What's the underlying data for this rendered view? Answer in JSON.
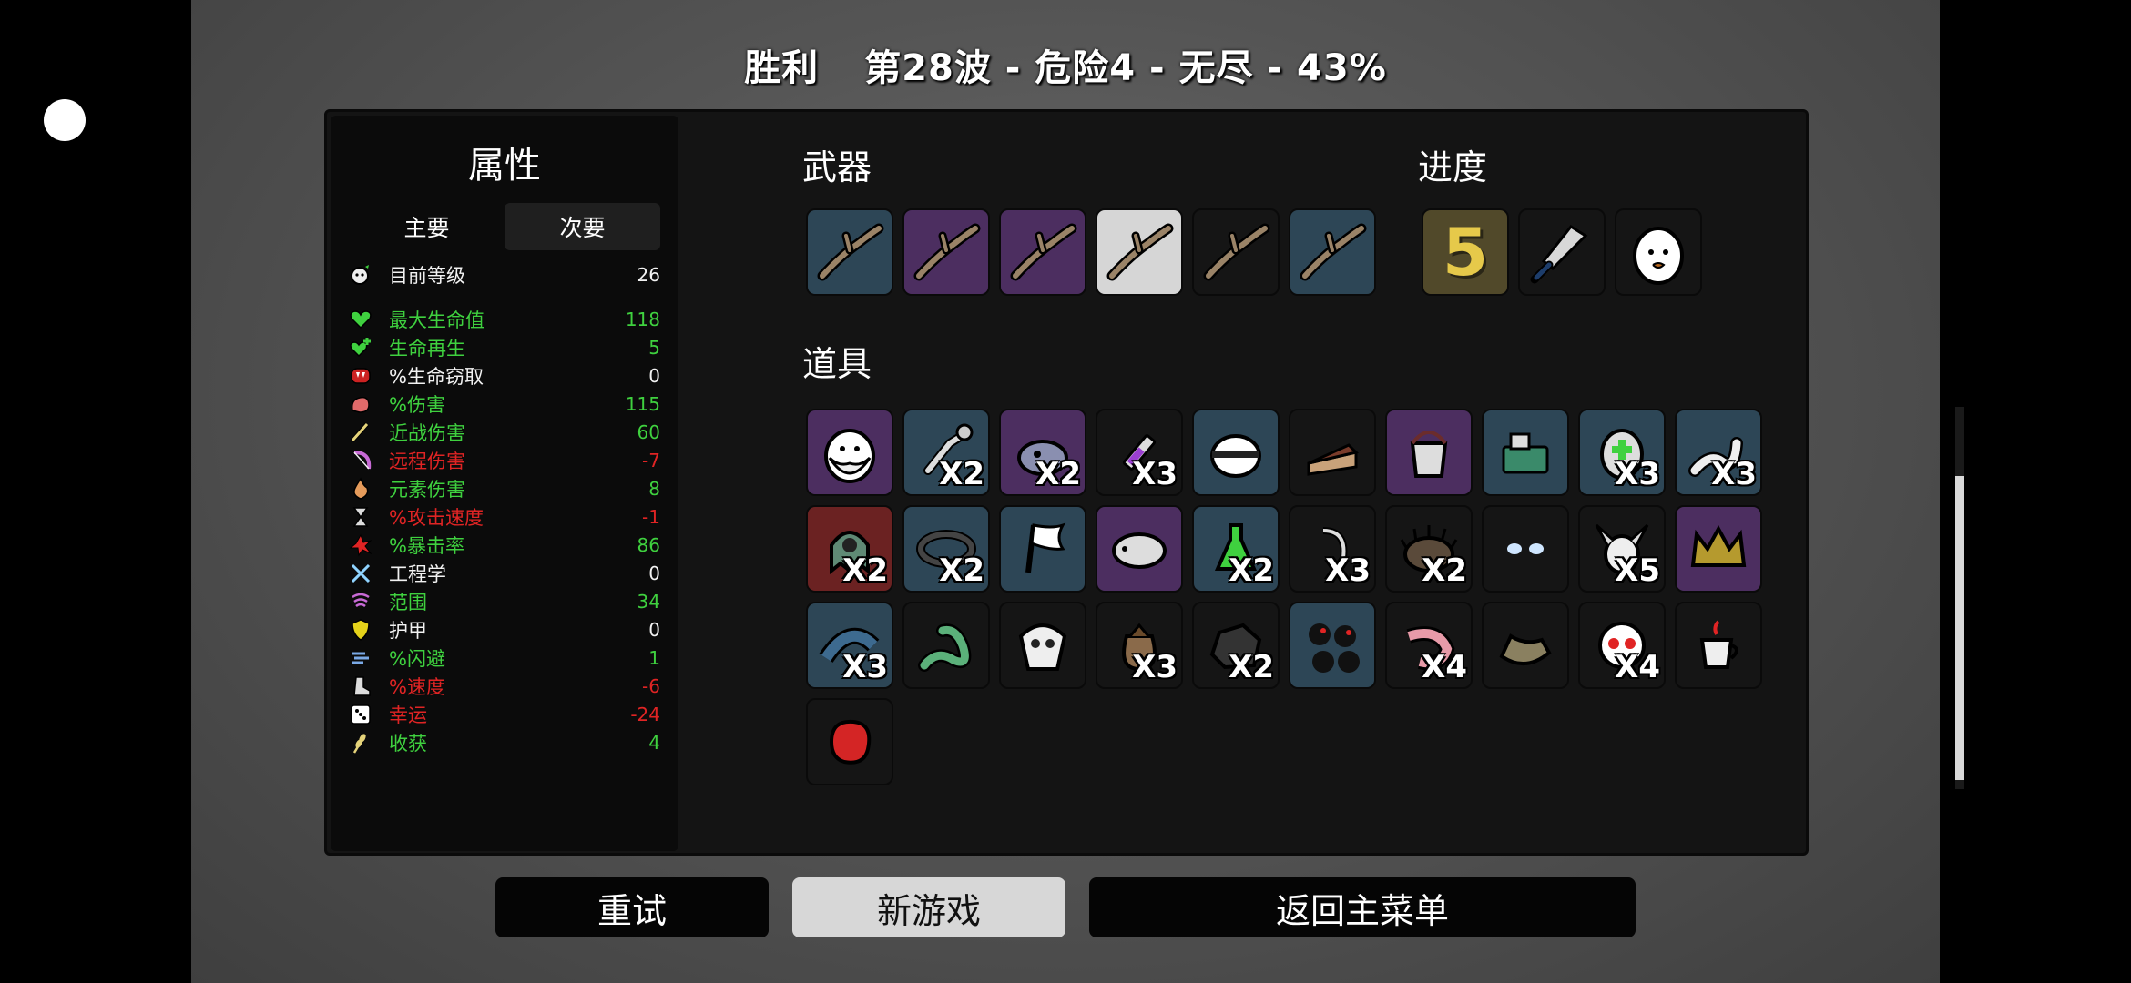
{
  "header": {
    "result": "胜利",
    "run_info": "第28波 - 危险4 - 无尽 - 43%"
  },
  "stats": {
    "title": "属性",
    "tabs": [
      "主要",
      "次要"
    ],
    "active_tab": "次要",
    "level": {
      "icon": "player-face-icon",
      "label": "目前等级",
      "value": "26"
    },
    "rows": [
      {
        "icon": "heart-icon",
        "label": "最大生命值",
        "value": "118",
        "color": "green"
      },
      {
        "icon": "heart-plus-icon",
        "label": "生命再生",
        "value": "5",
        "color": "green"
      },
      {
        "icon": "vampire-mouth-icon",
        "label": "%生命窃取",
        "value": "0",
        "color": "white"
      },
      {
        "icon": "muscle-icon",
        "label": "%伤害",
        "value": "115",
        "color": "green"
      },
      {
        "icon": "sword-icon",
        "label": "近战伤害",
        "value": "60",
        "color": "green"
      },
      {
        "icon": "bow-icon",
        "label": "远程伤害",
        "value": "-7",
        "color": "red"
      },
      {
        "icon": "flame-icon",
        "label": "元素伤害",
        "value": "8",
        "color": "green"
      },
      {
        "icon": "hourglass-icon",
        "label": "%攻击速度",
        "value": "-1",
        "color": "red"
      },
      {
        "icon": "crit-burst-icon",
        "label": "%暴击率",
        "value": "86",
        "color": "green"
      },
      {
        "icon": "wrench-cross-icon",
        "label": "工程学",
        "value": "0",
        "color": "white"
      },
      {
        "icon": "range-waves-icon",
        "label": "范围",
        "value": "34",
        "color": "green"
      },
      {
        "icon": "shield-icon",
        "label": "护甲",
        "value": "0",
        "color": "white"
      },
      {
        "icon": "dodge-wind-icon",
        "label": "%闪避",
        "value": "1",
        "color": "green"
      },
      {
        "icon": "boot-icon",
        "label": "%速度",
        "value": "-6",
        "color": "red"
      },
      {
        "icon": "dice-icon",
        "label": "幸运",
        "value": "-24",
        "color": "red"
      },
      {
        "icon": "wheat-icon",
        "label": "收获",
        "value": "4",
        "color": "green"
      }
    ]
  },
  "weapons": {
    "title": "武器",
    "items": [
      {
        "icon": "stick-weapon-icon",
        "tier": "blue"
      },
      {
        "icon": "stick-weapon-icon",
        "tier": "purple"
      },
      {
        "icon": "stick-weapon-icon",
        "tier": "purple"
      },
      {
        "icon": "stick-weapon-icon",
        "tier": "white"
      },
      {
        "icon": "stick-weapon-icon",
        "tier": "dark"
      },
      {
        "icon": "stick-weapon-icon",
        "tier": "blue"
      }
    ]
  },
  "progress": {
    "title": "进度",
    "items": [
      {
        "icon": "danger-five-icon",
        "label": "5",
        "tier": "gold"
      },
      {
        "icon": "cleaver-icon",
        "tier": "dark"
      },
      {
        "icon": "egg-character-icon",
        "tier": "dark"
      }
    ]
  },
  "items": {
    "title": "道具",
    "rows": [
      [
        {
          "icon": "bearded-face-icon",
          "tier": "purple",
          "qty": ""
        },
        {
          "icon": "bird-bone-icon",
          "tier": "blue",
          "qty": "X2"
        },
        {
          "icon": "alien-blob-icon",
          "tier": "purple",
          "qty": "X2"
        },
        {
          "icon": "syringe-icon",
          "tier": "dark",
          "qty": "X3"
        },
        {
          "icon": "helmet-chef-icon",
          "tier": "blue",
          "qty": ""
        },
        {
          "icon": "cake-slice-icon",
          "tier": "dark",
          "qty": ""
        },
        {
          "icon": "bucket-icon",
          "tier": "purple",
          "qty": ""
        },
        {
          "icon": "machine-icon",
          "tier": "blue",
          "qty": ""
        },
        {
          "icon": "medic-helmet-icon",
          "tier": "blue",
          "qty": "X3"
        },
        {
          "icon": "worm-icon",
          "tier": "blue",
          "qty": "X3"
        }
      ],
      [
        {
          "icon": "cyclops-ghost-icon",
          "tier": "red",
          "qty": "X2"
        },
        {
          "icon": "belt-icon",
          "tier": "blue",
          "qty": "X2"
        },
        {
          "icon": "white-flag-icon",
          "tier": "blue",
          "qty": ""
        },
        {
          "icon": "tardigrade-icon",
          "tier": "purple",
          "qty": ""
        },
        {
          "icon": "potion-flask-icon",
          "tier": "blue",
          "qty": "X2"
        },
        {
          "icon": "claw-hook-icon",
          "tier": "dark",
          "qty": "X3"
        },
        {
          "icon": "hedgehog-icon",
          "tier": "dark",
          "qty": "X2"
        },
        {
          "icon": "glowing-eyes-icon",
          "tier": "dark",
          "qty": ""
        },
        {
          "icon": "horned-skull-icon",
          "tier": "dark",
          "qty": "X5"
        },
        {
          "icon": "spiked-crown-icon",
          "tier": "purple",
          "qty": ""
        }
      ],
      [
        {
          "icon": "bandage-arm-icon",
          "tier": "blue",
          "qty": "X3"
        },
        {
          "icon": "snake-icon",
          "tier": "dark",
          "qty": ""
        },
        {
          "icon": "bone-mask-icon",
          "tier": "dark",
          "qty": ""
        },
        {
          "icon": "sack-icon",
          "tier": "dark",
          "qty": "X3"
        },
        {
          "icon": "rock-icon",
          "tier": "dark",
          "qty": "X2"
        },
        {
          "icon": "bombs-icon",
          "tier": "blue",
          "qty": ""
        },
        {
          "icon": "shrimp-icon",
          "tier": "dark",
          "qty": "X4"
        },
        {
          "icon": "genie-lamp-icon",
          "tier": "dark",
          "qty": ""
        },
        {
          "icon": "skull-icon",
          "tier": "dark",
          "qty": "X4"
        },
        {
          "icon": "coffee-cup-icon",
          "tier": "dark",
          "qty": ""
        }
      ],
      [
        {
          "icon": "boxing-glove-icon",
          "tier": "dark",
          "qty": ""
        }
      ]
    ]
  },
  "buttons": {
    "retry": "重试",
    "new_game": "新游戏",
    "main_menu": "返回主菜单"
  },
  "colors": {
    "green": "#3fd13f",
    "red": "#e02424",
    "tier_blue": "#2d4656",
    "tier_purple": "#4c2e60",
    "tier_red": "#6b2222",
    "tier_white": "#d6d6d6"
  }
}
